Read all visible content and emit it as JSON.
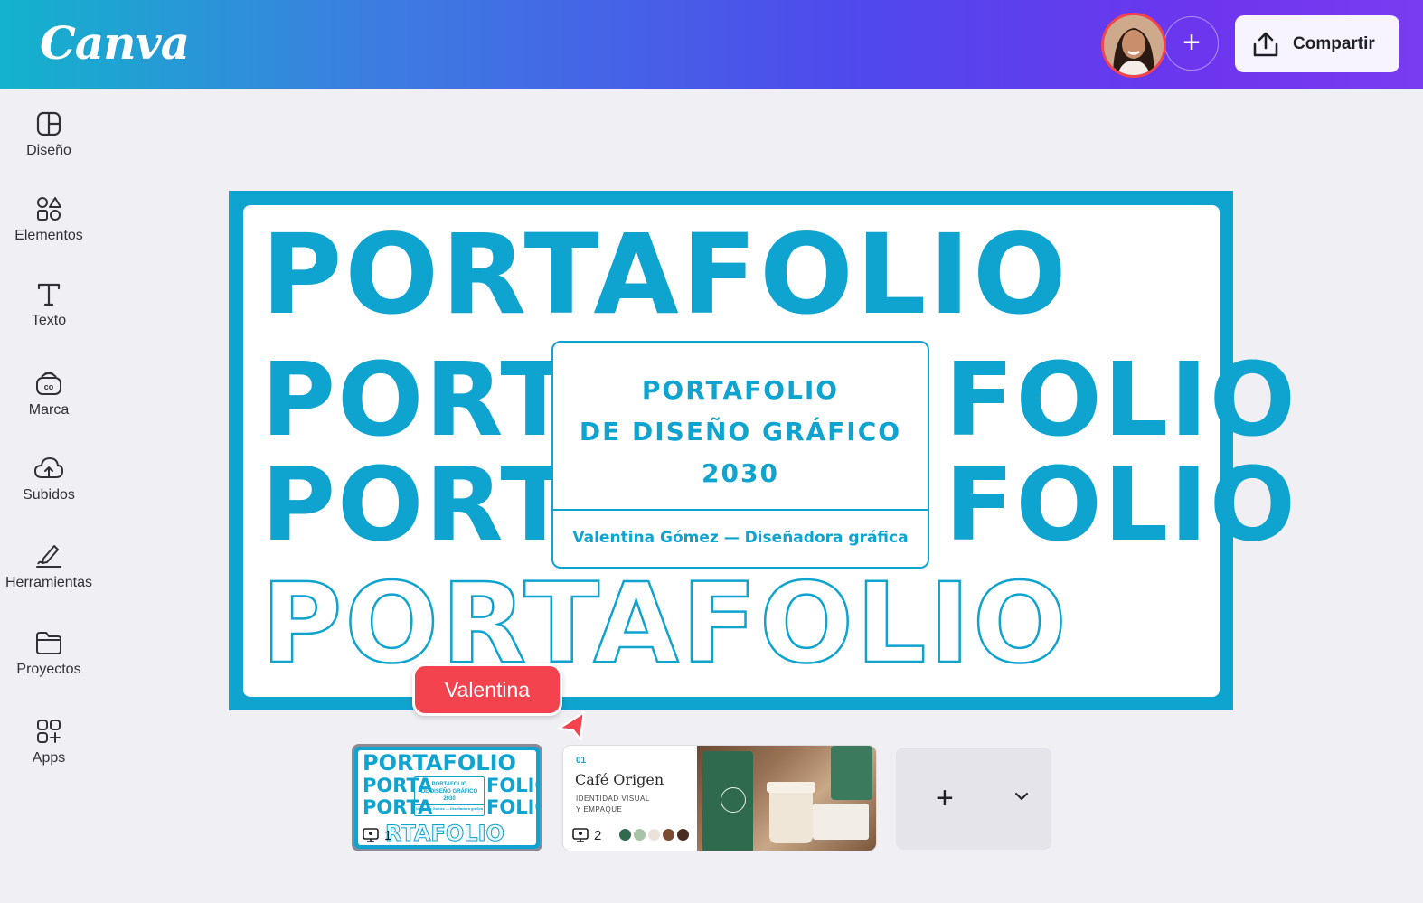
{
  "app": {
    "logo": "Canva"
  },
  "header": {
    "share_label": "Compartir",
    "add_collaborator": "+"
  },
  "sidebar": {
    "items": [
      {
        "label": "Diseño",
        "icon": "layout-icon"
      },
      {
        "label": "Elementos",
        "icon": "shapes-icon"
      },
      {
        "label": "Texto",
        "icon": "text-icon"
      },
      {
        "label": "Marca",
        "icon": "brand-icon"
      },
      {
        "label": "Subidos",
        "icon": "cloud-upload-icon"
      },
      {
        "label": "Herramientas",
        "icon": "draw-tool-icon"
      },
      {
        "label": "Proyectos",
        "icon": "folder-icon"
      },
      {
        "label": "Apps",
        "icon": "apps-grid-icon"
      }
    ]
  },
  "slide": {
    "top_word": "PORTAFOLIO",
    "left_word": "PORTA",
    "right_word": "FOLIO",
    "outline_word": "PORTAFOLIO",
    "center_lines": [
      "PORTAFOLIO",
      "DE DISEÑO GRÁFICO",
      "2030"
    ],
    "center_sub": "Valentina Gómez — Diseñadora gráfica",
    "accent_color": "#0fa3cf"
  },
  "collaborator_cursor": {
    "name": "Valentina",
    "color": "#f2434f"
  },
  "pages": [
    {
      "number": "1",
      "top_word": "PORTAFOLIO",
      "left_word": "PORTA",
      "right_word": "FOLIO",
      "box_lines": [
        "PORTAFOLIO",
        "DE DISEÑO GRÁFICO",
        "2030"
      ],
      "box_sub": "Valentina Gómez — Diseñadora gráfica",
      "outline_word": "RTAFOLIO"
    },
    {
      "number": "2",
      "index": "01",
      "title": "Café Origen",
      "subtitle_1": "IDENTIDAD VISUAL",
      "subtitle_2": "Y EMPAQUE",
      "palette": [
        "#2f6a4f",
        "#a9c3a6",
        "#ebe3d7",
        "#7a4a32",
        "#4a2c1e"
      ]
    }
  ],
  "add_page": {
    "plus": "+"
  }
}
